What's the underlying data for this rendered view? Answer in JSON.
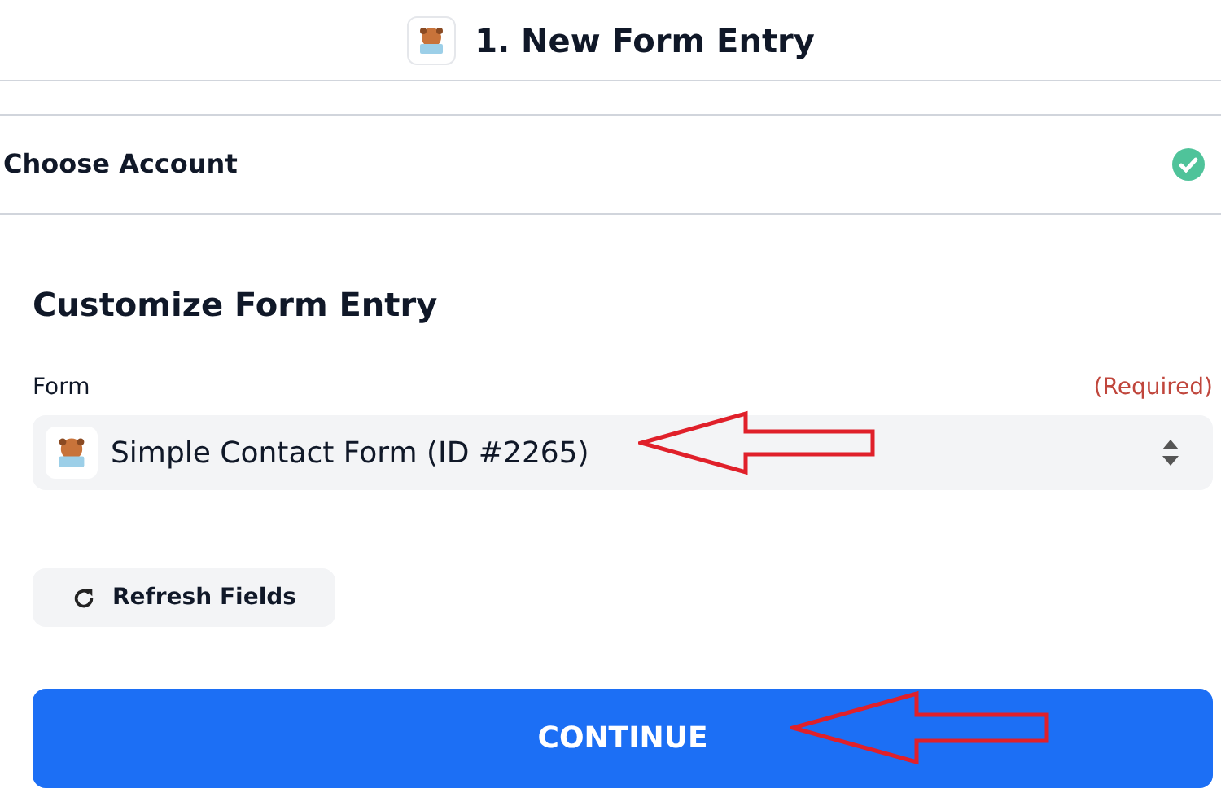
{
  "header": {
    "title": "1. New Form Entry"
  },
  "account": {
    "label": "Choose Account",
    "connected": true
  },
  "section": {
    "title": "Customize Form Entry"
  },
  "form_field": {
    "label": "Form",
    "required_note": "(Required)",
    "value": "Simple Contact Form (ID #2265)"
  },
  "buttons": [
    {
      "kind": "secondary",
      "label": "Refresh Fields"
    },
    {
      "kind": "primary",
      "label": "CONTINUE"
    }
  ]
}
